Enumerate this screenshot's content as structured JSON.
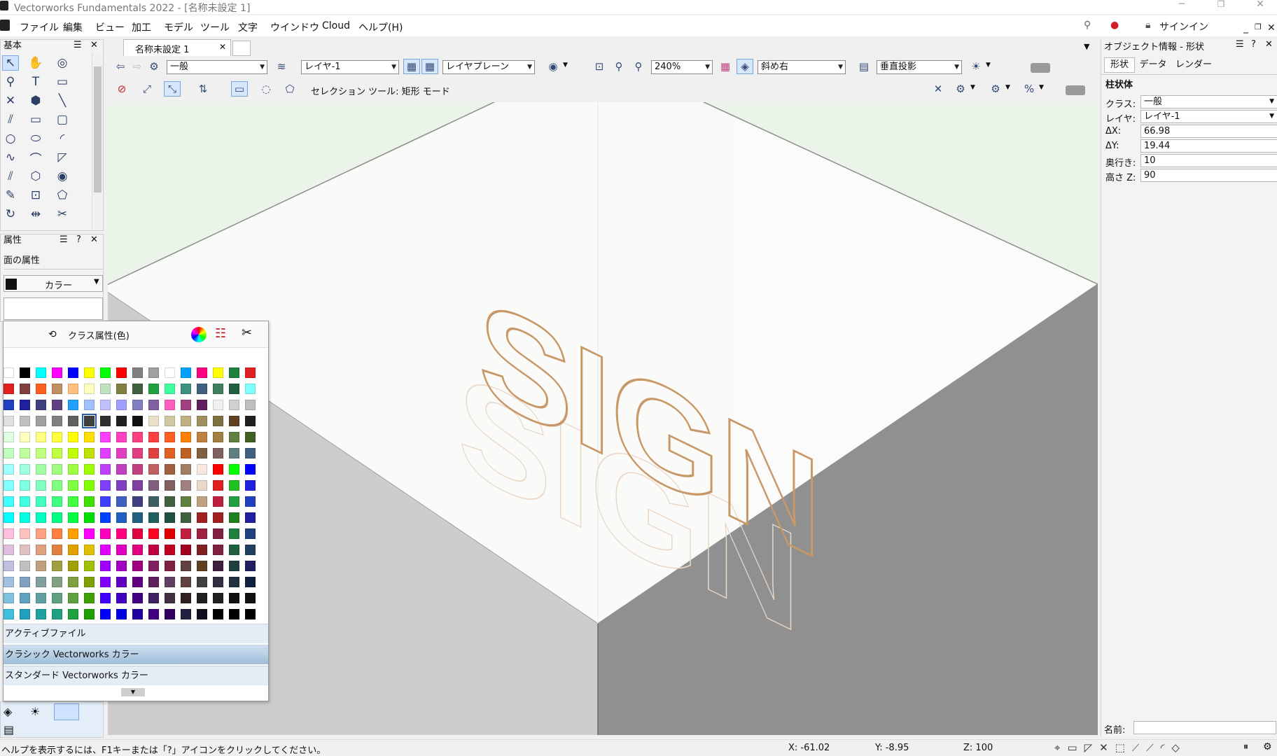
{
  "window": {
    "title": "Vectorworks Fundamentals 2022 - [名称未設定 1]"
  },
  "menus": [
    "ファイル",
    "編集",
    "ビュー",
    "加工",
    "モデル",
    "ツール",
    "文字",
    "ウインドウ",
    "Cloud",
    "ヘルプ(H)"
  ],
  "menubar_right": {
    "signin": "サインイン"
  },
  "basic_palette": {
    "title": "基本"
  },
  "attributes_palette": {
    "title": "属性",
    "fill_label": "面の属性",
    "fill_mode": "カラー"
  },
  "color_popup": {
    "class_attr_label": "クラス属性(色)",
    "libraries": [
      "アクティブファイル",
      "クラシック Vectorworks カラー",
      "スタンダード Vectorworks カラー"
    ],
    "active_library": 1,
    "selected_swatch": 53,
    "swatches": [
      "#ffffff",
      "#000000",
      "#00ffff",
      "#ff00ff",
      "#0000ff",
      "#ffff00",
      "#00ff00",
      "#ff0000",
      "#808080",
      "#a0a0a0",
      "#ffffff",
      "#00a0ff",
      "#ff0080",
      "#ffff00",
      "#208040",
      "#e02020",
      "#e02020",
      "#804040",
      "#ff6020",
      "#c09060",
      "#ffc080",
      "#ffffc0",
      "#c0e0c0",
      "#808040",
      "#406040",
      "#20a040",
      "#40ffa0",
      "#409080",
      "#406080",
      "#408060",
      "#206040",
      "#80ffff",
      "#2040c0",
      "#2020a0",
      "#404080",
      "#604080",
      "#20a0ff",
      "#a0c0ff",
      "#c0c0ff",
      "#a0a0ff",
      "#8080c0",
      "#8060a0",
      "#ff60c0",
      "#a04080",
      "#602060",
      "#f0f0f0",
      "#d0d0d0",
      "#c0c0c0",
      "#e0e0e0",
      "#c0c0c0",
      "#a0a0a0",
      "#808080",
      "#606060",
      "#404040",
      "#303030",
      "#202020",
      "#101010",
      "#e8e0c8",
      "#d0c8a0",
      "#c0b080",
      "#a09060",
      "#807040",
      "#604020",
      "#202020",
      "#e0ffe0",
      "#ffffc0",
      "#ffff80",
      "#ffff40",
      "#ffff00",
      "#ffe000",
      "#ff40ff",
      "#ff40c0",
      "#ff4080",
      "#ff4040",
      "#ff6020",
      "#ff8000",
      "#c08040",
      "#a08040",
      "#608040",
      "#406020",
      "#c0ffc0",
      "#c0ffa0",
      "#c0ff80",
      "#c0ff40",
      "#c0ff00",
      "#c0e000",
      "#e040ff",
      "#e040c0",
      "#e04080",
      "#e04040",
      "#e06020",
      "#c06020",
      "#806040",
      "#806060",
      "#608080",
      "#406080",
      "#a0ffff",
      "#a0ffe0",
      "#a0ffa0",
      "#a0ff80",
      "#a0ff40",
      "#a0ff00",
      "#c040ff",
      "#c040c0",
      "#c04080",
      "#c06060",
      "#a06040",
      "#a08060",
      "#f8e8e0",
      "#ff0000",
      "#00ff00",
      "#0000ff",
      "#80ffff",
      "#80ffe0",
      "#80ffc0",
      "#80ff80",
      "#80ff40",
      "#80ff00",
      "#8040ff",
      "#8040c0",
      "#8040a0",
      "#806080",
      "#806060",
      "#a08080",
      "#e8d8c8",
      "#e02020",
      "#20c020",
      "#2020e0",
      "#40ffff",
      "#40ffe0",
      "#40ffc0",
      "#40ff80",
      "#40ff40",
      "#40e000",
      "#4040ff",
      "#4060c0",
      "#404080",
      "#406060",
      "#406040",
      "#608040",
      "#c0a080",
      "#c02040",
      "#20a040",
      "#2040c0",
      "#00ffff",
      "#00ffe0",
      "#00ffc0",
      "#00ff80",
      "#00ff40",
      "#00e000",
      "#0040ff",
      "#2060c0",
      "#206080",
      "#206060",
      "#205040",
      "#406040",
      "#a02020",
      "#a02020",
      "#208020",
      "#2020a0",
      "#ffc0e0",
      "#ffc0c0",
      "#ffa080",
      "#ff8040",
      "#ffa000",
      "#ff00ff",
      "#ff00c0",
      "#ff0080",
      "#e00040",
      "#ff0020",
      "#e00000",
      "#c02040",
      "#a02040",
      "#802040",
      "#208040",
      "#204080",
      "#e0c0e0",
      "#e0c0c0",
      "#e0a080",
      "#e08040",
      "#e0a000",
      "#e0c000",
      "#e000ff",
      "#e000c0",
      "#e00080",
      "#c00040",
      "#c00020",
      "#a00020",
      "#802020",
      "#802040",
      "#206040",
      "#204060",
      "#c0c0e0",
      "#c0c0c0",
      "#c0a080",
      "#a0a040",
      "#a0a000",
      "#a0c000",
      "#a000ff",
      "#a000c0",
      "#a00080",
      "#802060",
      "#802040",
      "#604040",
      "#604020",
      "#402040",
      "#204040",
      "#202060",
      "#a0c0e0",
      "#80a0c0",
      "#80a0a0",
      "#80a080",
      "#80a040",
      "#80a000",
      "#8000ff",
      "#6000c0",
      "#600080",
      "#602060",
      "#604060",
      "#604040",
      "#404040",
      "#303040",
      "#203040",
      "#102040",
      "#80c0e0",
      "#60a0c0",
      "#60a0a0",
      "#60a080",
      "#60a040",
      "#40a000",
      "#4000ff",
      "#4000c0",
      "#400080",
      "#402060",
      "#403040",
      "#302020",
      "#202020",
      "#202020",
      "#101010",
      "#101010",
      "#40c0e0",
      "#20a0c0",
      "#20a0a0",
      "#20a080",
      "#20a040",
      "#20a000",
      "#0000ff",
      "#0000e0",
      "#2000a0",
      "#400080",
      "#300060",
      "#202040",
      "#101020",
      "#000000",
      "#000000",
      "#000000"
    ]
  },
  "doc": {
    "tab_name": "名称未設定 1"
  },
  "view_bar": {
    "class": "一般",
    "layer": "レイヤ-1",
    "plane": "レイヤプレーン",
    "zoom": "240%",
    "view": "斜め右",
    "projection": "垂直投影"
  },
  "tool_bar": {
    "mode_text": "セレクション ツール: 矩形 モード"
  },
  "drawing": {
    "text3d": "SIGN"
  },
  "oip": {
    "title": "オブジェクト情報 - 形状",
    "tabs": [
      "形状",
      "データ",
      "レンダー"
    ],
    "object_type": "柱状体",
    "fields": [
      {
        "label": "クラス:",
        "value": "一般",
        "dropdown": true
      },
      {
        "label": "レイヤ:",
        "value": "レイヤ-1",
        "dropdown": true
      },
      {
        "label": "ΔX:",
        "value": "66.98"
      },
      {
        "label": "ΔY:",
        "value": "19.44"
      },
      {
        "label": "奥行き:",
        "value": "10"
      },
      {
        "label": "高さ Z:",
        "value": "90"
      }
    ],
    "name_label": "名前:"
  },
  "status": {
    "hint": "ヘルプを表示するには、F1キーまたは「?」アイコンをクリックしてください。",
    "x": "X: -61.02",
    "y": "Y: -8.95",
    "z": "Z: 100"
  }
}
